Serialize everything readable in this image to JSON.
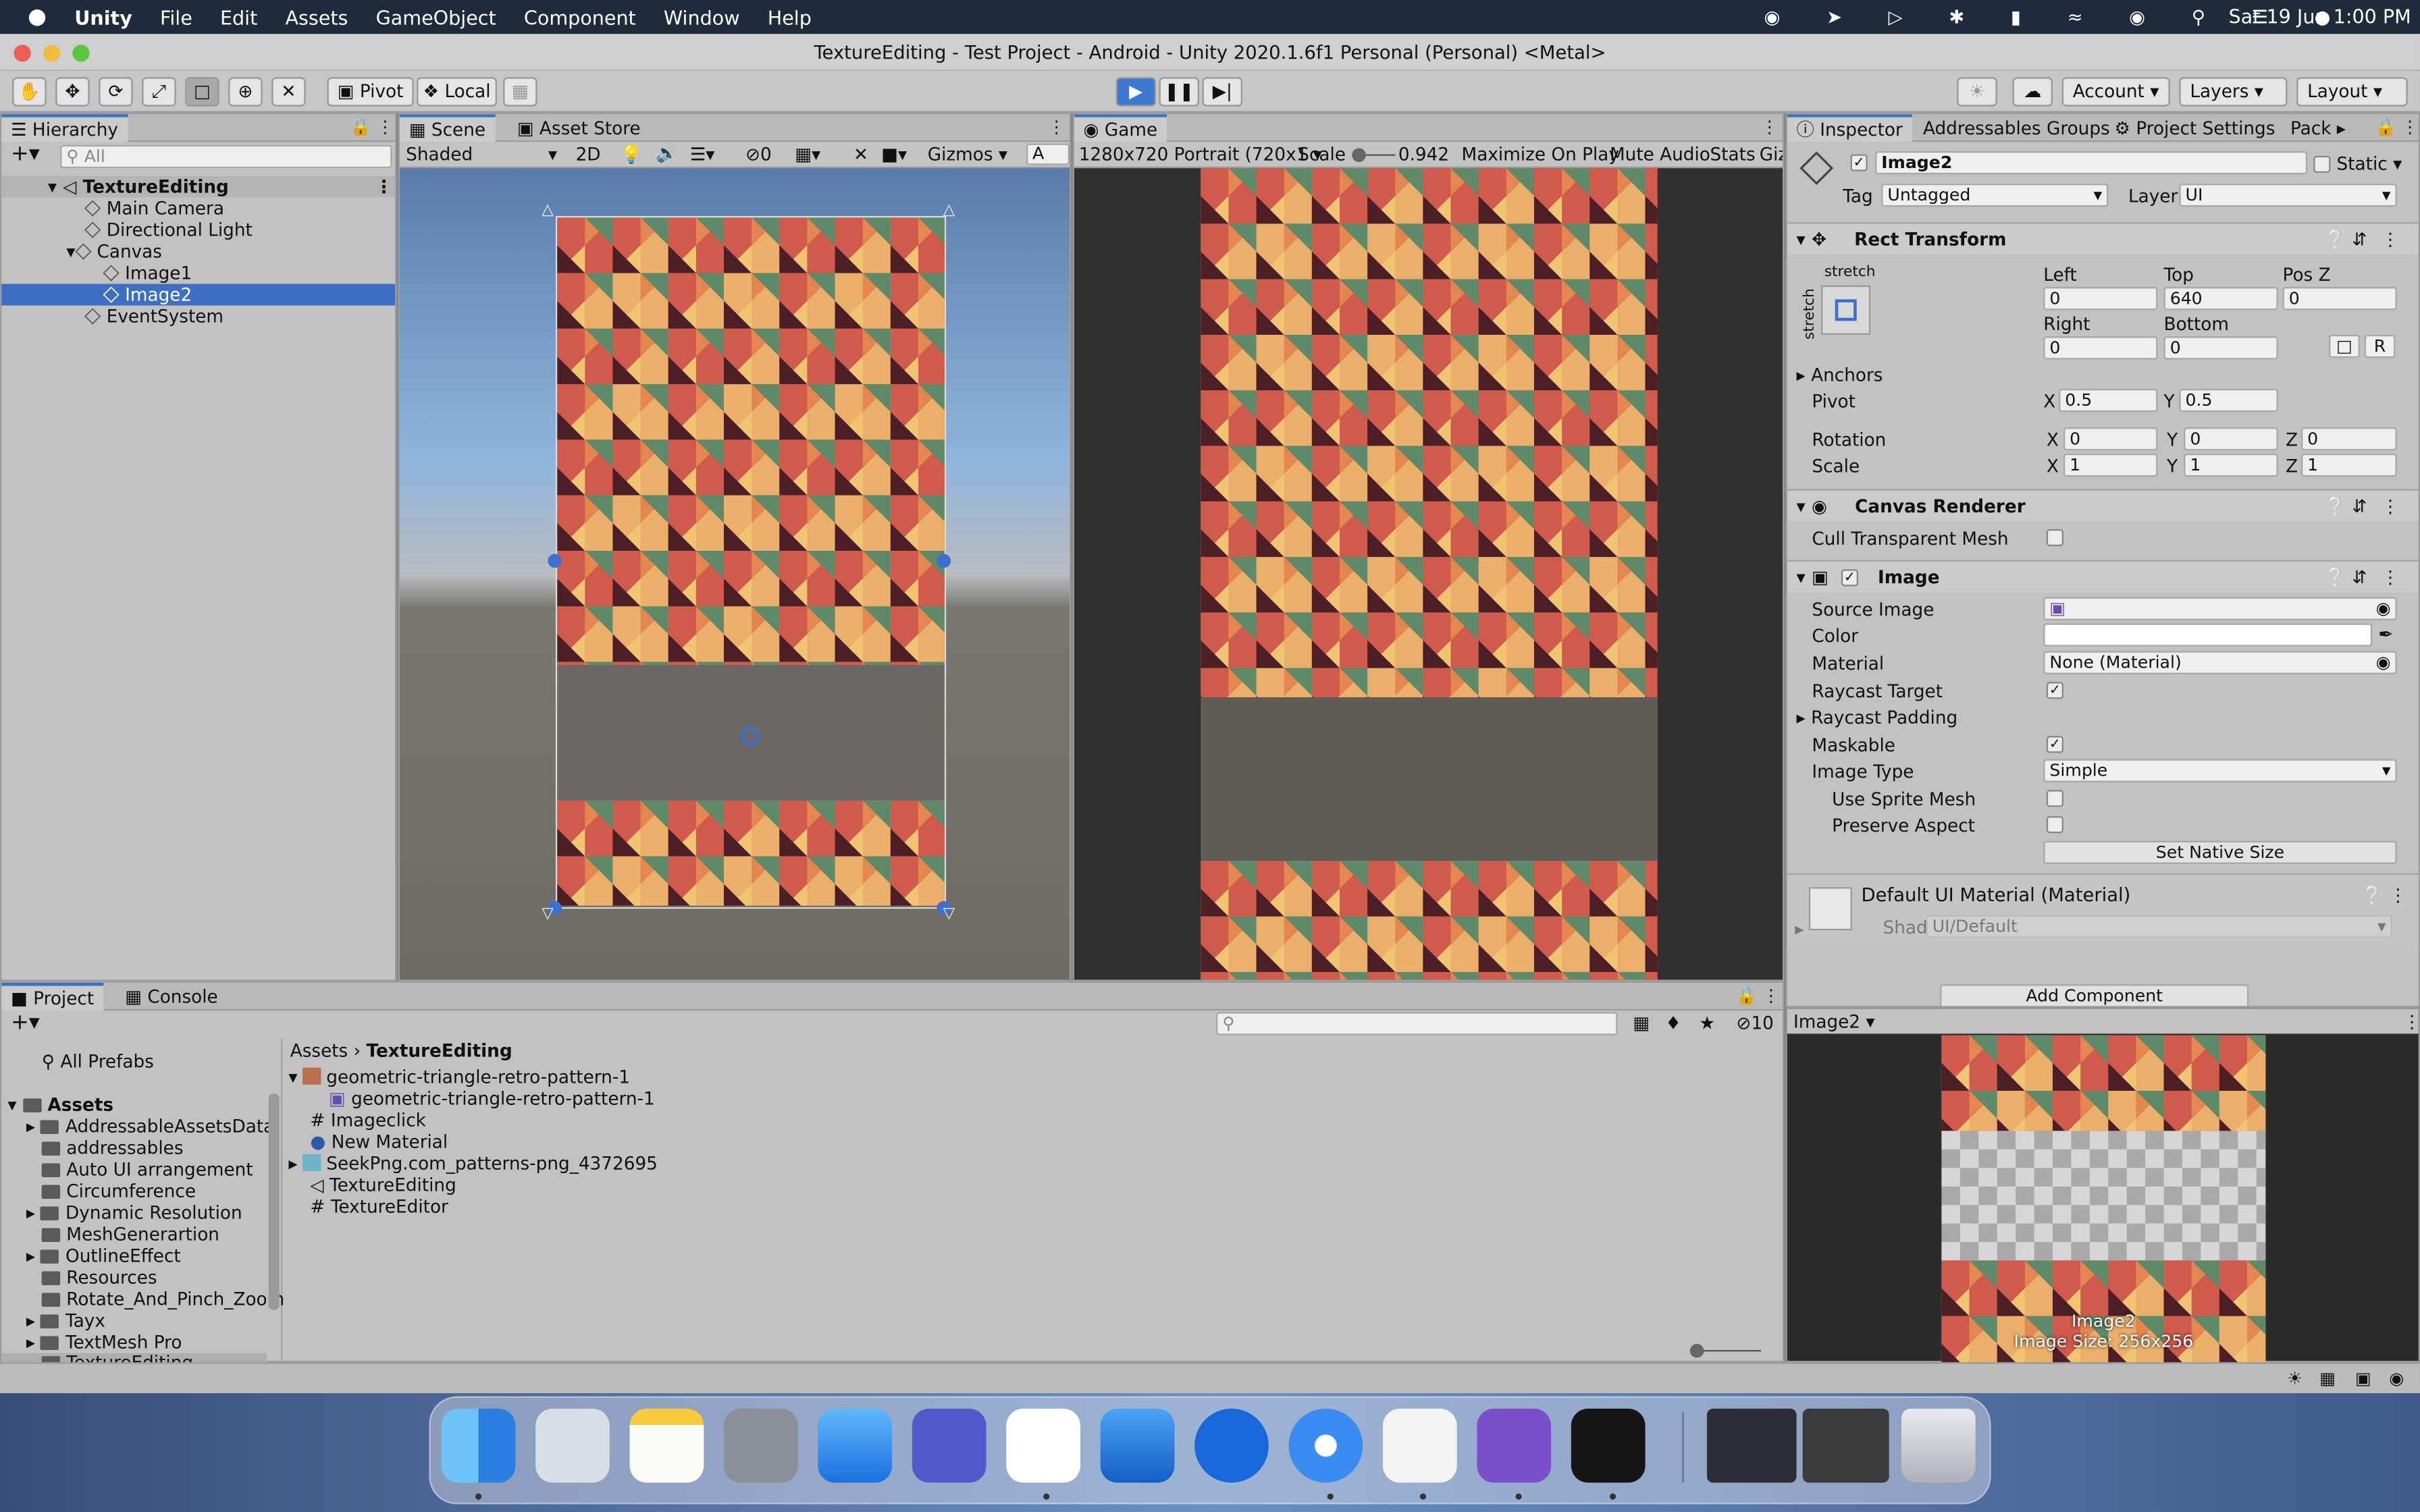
{
  "menubar": {
    "app": "Unity",
    "items": [
      "File",
      "Edit",
      "Assets",
      "GameObject",
      "Component",
      "Window",
      "Help"
    ],
    "datetime": "Sat 19 Jun  1:00 PM"
  },
  "window": {
    "title": "TextureEditing - Test Project - Android - Unity 2020.1.6f1 Personal (Personal) <Metal>"
  },
  "toolbar": {
    "pivot": "Pivot",
    "local": "Local",
    "account": "Account",
    "layers": "Layers",
    "layout": "Layout"
  },
  "hierarchy": {
    "tab": "Hierarchy",
    "search_placeholder": "All",
    "scene": "TextureEditing",
    "items": [
      "Main Camera",
      "Directional Light",
      "Canvas",
      "Image1",
      "Image2",
      "EventSystem"
    ]
  },
  "scene": {
    "tab": "Scene",
    "tab2": "Asset Store",
    "shading": "Shaded",
    "mode2d": "2D",
    "layers_count": "0",
    "gizmos": "Gizmos",
    "search": "A"
  },
  "game": {
    "tab": "Game",
    "resolution": "1280x720 Portrait (720x1",
    "scale_label": "Scale",
    "scale_value": "0.942",
    "maximize": "Maximize On Play",
    "mute": "Mute Audio",
    "stats": "Stats",
    "gizmos": "Giz"
  },
  "inspector": {
    "tabs": [
      "Inspector",
      "Addressables Groups",
      "Project Settings",
      "Pack"
    ],
    "object_name": "Image2",
    "static": "Static",
    "tag_label": "Tag",
    "tag_value": "Untagged",
    "layer_label": "Layer",
    "layer_value": "UI",
    "rect": {
      "title": "Rect Transform",
      "stretch": "stretch",
      "stretch_v": "stretch",
      "left_label": "Left",
      "left": "0",
      "top_label": "Top",
      "top": "640",
      "posz_label": "Pos Z",
      "posz": "0",
      "right_label": "Right",
      "right": "0",
      "bottom_label": "Bottom",
      "bottom": "0",
      "r_btn": "R",
      "anchors": "Anchors",
      "pivot": "Pivot",
      "pivot_x": "0.5",
      "pivot_y": "0.5",
      "rotation": "Rotation",
      "rot_x": "0",
      "rot_y": "0",
      "rot_z": "0",
      "scale": "Scale",
      "scale_x": "1",
      "scale_y": "1",
      "scale_z": "1",
      "x": "X",
      "y": "Y",
      "z": "Z"
    },
    "canvas_renderer": {
      "title": "Canvas Renderer",
      "cull": "Cull Transparent Mesh"
    },
    "image": {
      "title": "Image",
      "source": "Source Image",
      "color": "Color",
      "material": "Material",
      "material_value": "None (Material)",
      "raycast": "Raycast Target",
      "raycast_padding": "Raycast Padding",
      "maskable": "Maskable",
      "image_type": "Image Type",
      "image_type_value": "Simple",
      "use_sprite_mesh": "Use Sprite Mesh",
      "preserve": "Preserve Aspect",
      "native": "Set Native Size"
    },
    "material": {
      "title": "Default UI Material (Material)",
      "shader_label": "Shader",
      "shader_value": "UI/Default"
    },
    "add_component": "Add Component",
    "preview": {
      "name": "Image2",
      "line1": "Image2",
      "line2": "Image Size: 256x256"
    }
  },
  "project": {
    "tab": "Project",
    "tab2": "Console",
    "favorites": "All Prefabs",
    "root": "Assets",
    "folders": [
      "AddressableAssetsData",
      "addressables",
      "Auto UI arrangement",
      "Circumference",
      "Dynamic Resolution",
      "MeshGenerartion",
      "OutlineEffect",
      "Resources",
      "Rotate_And_Pinch_Zoom",
      "Tayx",
      "TextMesh Pro",
      "TextureEditing"
    ],
    "breadcrumb_root": "Assets",
    "breadcrumb_current": "TextureEditing",
    "hidden_count": "10",
    "files": [
      "geometric-triangle-retro-pattern-1",
      "geometric-triangle-retro-pattern-1",
      "Imageclick",
      "New Material",
      "SeekPng.com_patterns-png_4372695",
      "TextureEditing",
      "TextureEditor"
    ]
  },
  "colors": {
    "accent": "#3d6fc2",
    "panel": "#c2c2c2"
  }
}
